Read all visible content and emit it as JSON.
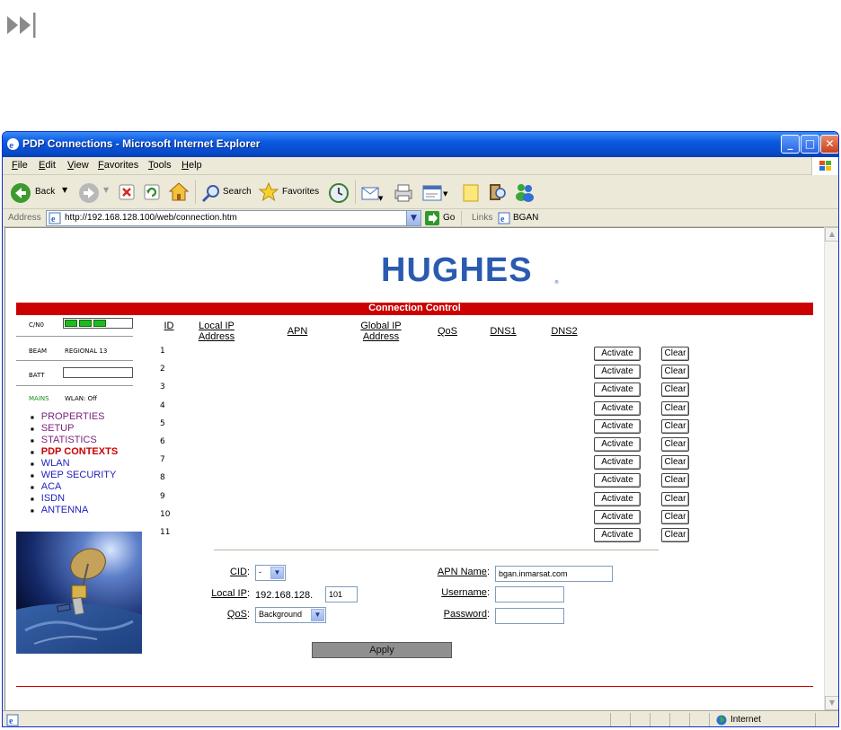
{
  "window": {
    "title": "PDP Connections - Microsoft Internet Explorer",
    "menu": [
      "File",
      "Edit",
      "View",
      "Favorites",
      "Tools",
      "Help"
    ]
  },
  "toolbar": {
    "back": "Back",
    "search": "Search",
    "favorites": "Favorites"
  },
  "address": {
    "label": "Address",
    "url": "http://192.168.128.100/web/connection.htm",
    "go": "Go",
    "links": "Links",
    "bgan_link": "BGAN"
  },
  "page": {
    "logo": "HUGHES",
    "header_title": "Connection Control",
    "sidebar": {
      "cn0_label": "C/N0",
      "cn0_level": 0.6,
      "beam_label": "BEAM",
      "beam_value": "REGIONAL 13",
      "batt_label": "BATT",
      "mains_label": "MAINS",
      "wlan_status": "WLAN: Off",
      "nav": [
        {
          "label": "PROPERTIES",
          "color": "#7a1f7a",
          "active": false
        },
        {
          "label": "SETUP",
          "color": "#7a1f7a",
          "active": false
        },
        {
          "label": "STATISTICS",
          "color": "#7a1f7a",
          "active": false
        },
        {
          "label": "PDP CONTEXTS",
          "color": "#cc0000",
          "active": true
        },
        {
          "label": "WLAN",
          "color": "#2222bb",
          "active": false
        },
        {
          "label": "WEP SECURITY",
          "color": "#2222bb",
          "active": false
        },
        {
          "label": "ACA",
          "color": "#2222bb",
          "active": false
        },
        {
          "label": "ISDN",
          "color": "#2222bb",
          "active": false
        },
        {
          "label": "ANTENNA",
          "color": "#2222bb",
          "active": false
        }
      ]
    },
    "table": {
      "headers": {
        "id": "ID",
        "local_ip_1": "Local IP",
        "local_ip_2": "Address",
        "apn": "APN",
        "global_ip_1": "Global IP",
        "global_ip_2": "Address",
        "qos": "QoS",
        "dns1": "DNS1",
        "dns2": "DNS2"
      },
      "rows": [
        "1",
        "2",
        "3",
        "4",
        "5",
        "6",
        "7",
        "8",
        "9",
        "10",
        "11"
      ],
      "activate_label": "Activate",
      "clear_label": "Clear"
    },
    "form": {
      "cid_label": "CID",
      "cid_value": "-",
      "local_ip_label": "Local IP",
      "local_ip_prefix": "192.168.128.",
      "local_ip_suffix": "101",
      "qos_label": "QoS",
      "qos_value": "Background",
      "apn_name_label": "APN Name",
      "apn_name_value": "bgan.inmarsat.com",
      "username_label": "Username",
      "password_label": "Password",
      "apply_label": "Apply"
    }
  },
  "status": {
    "zone": "Internet"
  }
}
